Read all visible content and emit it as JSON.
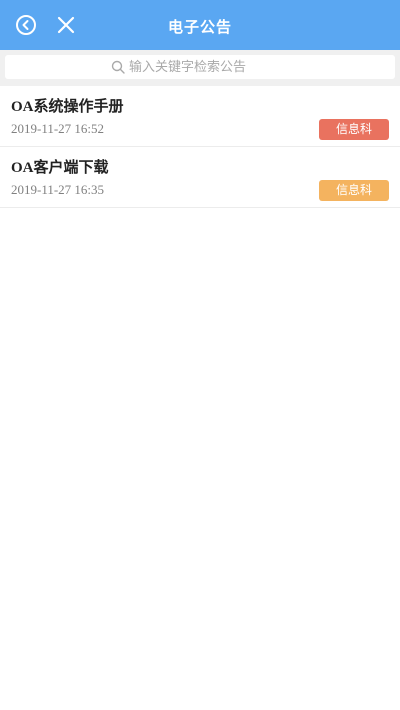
{
  "header": {
    "title": "电子公告",
    "back_icon": "back-circle-icon",
    "close_icon": "close-icon"
  },
  "search": {
    "placeholder": "输入关键字检索公告",
    "value": ""
  },
  "notices": [
    {
      "title": "OA系统操作手册",
      "date": "2019-11-27 16:52",
      "department": "信息科",
      "badge_color": "#e9725f"
    },
    {
      "title": "OA客户端下载",
      "date": "2019-11-27 16:35",
      "department": "信息科",
      "badge_color": "#f4b35f"
    }
  ],
  "colors": {
    "header_bg": "#5aa7f2",
    "search_bg": "#f0f0f0"
  }
}
